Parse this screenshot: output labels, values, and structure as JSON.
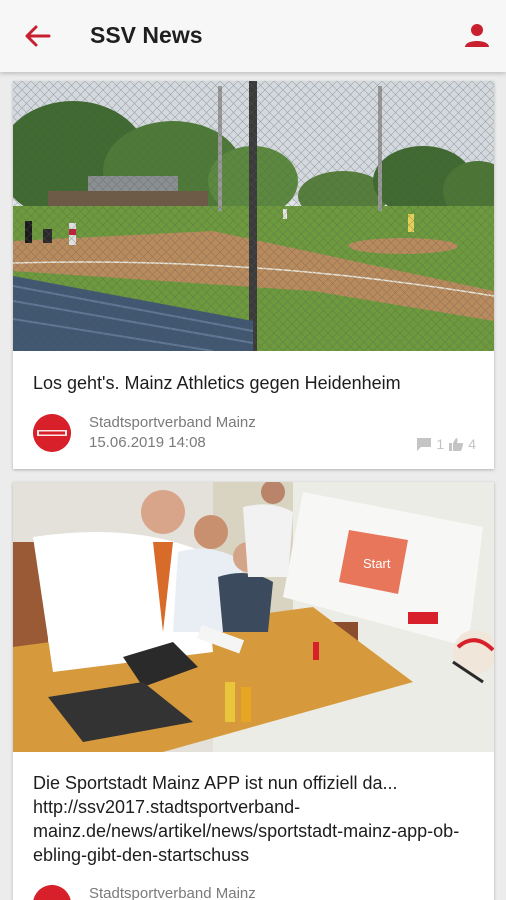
{
  "app_bar": {
    "title": "SSV News",
    "icons": {
      "back": "arrow-left-icon",
      "profile": "person-icon"
    },
    "accent_color": "#c8202f"
  },
  "feed": {
    "posts": [
      {
        "image": "baseball-field-photo",
        "title": "Los geht's. Mainz Athletics gegen Heidenheim",
        "author": "Stadtsportverband Mainz",
        "date": "15.06.2019 14:08",
        "comments": "1",
        "likes": "4"
      },
      {
        "image": "press-conference-photo",
        "title": "Die Sportstadt Mainz APP ist nun offiziell da... http://ssv2017.stadtsportverband-mainz.de/news/artikel/news/sportstadt-mainz-app-ob-ebling-gibt-den-startschuss",
        "author": "Stadtsportverband Mainz",
        "slide_text": "Start"
      }
    ]
  }
}
